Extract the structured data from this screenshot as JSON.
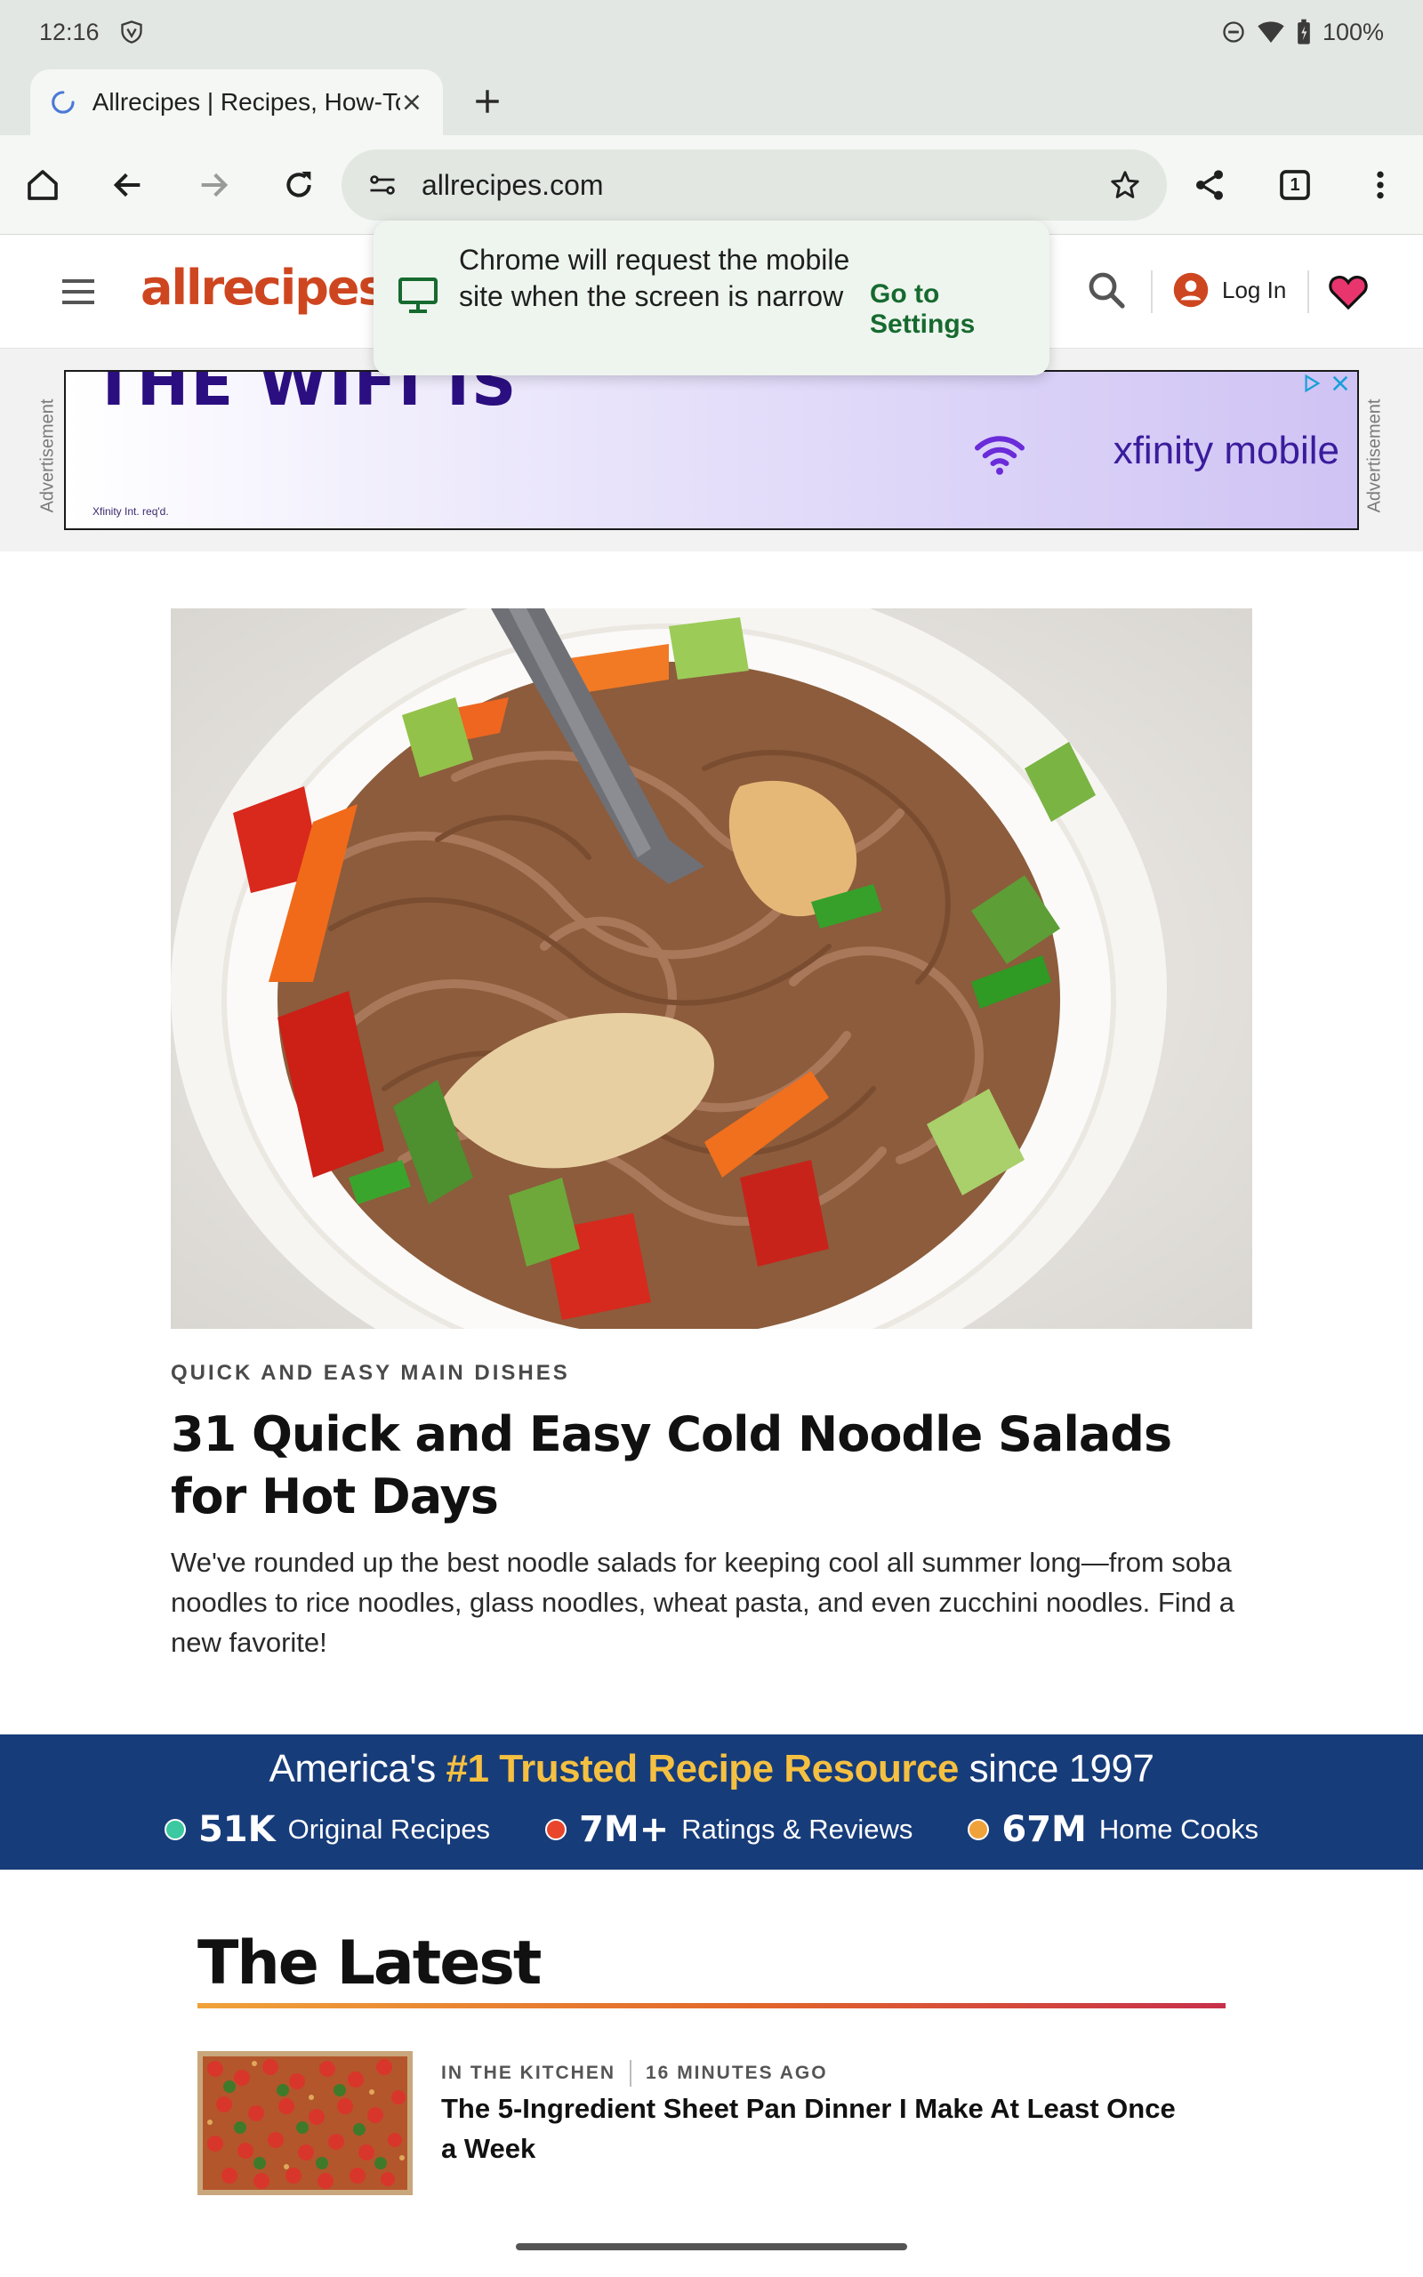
{
  "status_bar": {
    "time": "12:16",
    "battery": "100%"
  },
  "browser": {
    "tab_title": "Allrecipes | Recipes, How-To",
    "url": "allrecipes.com",
    "tab_count": "1"
  },
  "tooltip": {
    "message": "Chrome will request the mobile site when the screen is narrow",
    "action": "Go to Settings"
  },
  "site": {
    "logo": "allrecipes",
    "login_label": "Log In"
  },
  "ad": {
    "side_label": "Advertisement",
    "headline": "THE WIFI IS",
    "brand": "xfinity mobile",
    "fine_print": "Xfinity Int. req'd."
  },
  "hero": {
    "kicker": "QUICK AND EASY MAIN DISHES",
    "title": "31 Quick and Easy Cold Noodle Salads for Hot Days",
    "description": "We've rounded up the best noodle salads for keeping cool all summer long—from soba noodles to rice noodles, glass noodles, wheat pasta, and even zucchini noodles. Find a new favorite!"
  },
  "trust": {
    "prefix": "America's",
    "highlight": "#1 Trusted Recipe Resource",
    "suffix": "since 1997",
    "stats": [
      {
        "value": "51K",
        "label": "Original Recipes",
        "color": "#3cc8a0"
      },
      {
        "value": "7M+",
        "label": "Ratings & Reviews",
        "color": "#e8452c"
      },
      {
        "value": "67M",
        "label": "Home Cooks",
        "color": "#f0a23a"
      }
    ]
  },
  "latest": {
    "heading": "The Latest",
    "articles": [
      {
        "category": "IN THE KITCHEN",
        "time": "16 MINUTES AGO",
        "title": "The 5-Ingredient Sheet Pan Dinner I Make At Least Once a Week"
      }
    ]
  },
  "colors": {
    "brand": "#ce4620",
    "trust_bg": "#173c7a",
    "trust_highlight": "#f5c041",
    "settings_link": "#166a2f"
  }
}
